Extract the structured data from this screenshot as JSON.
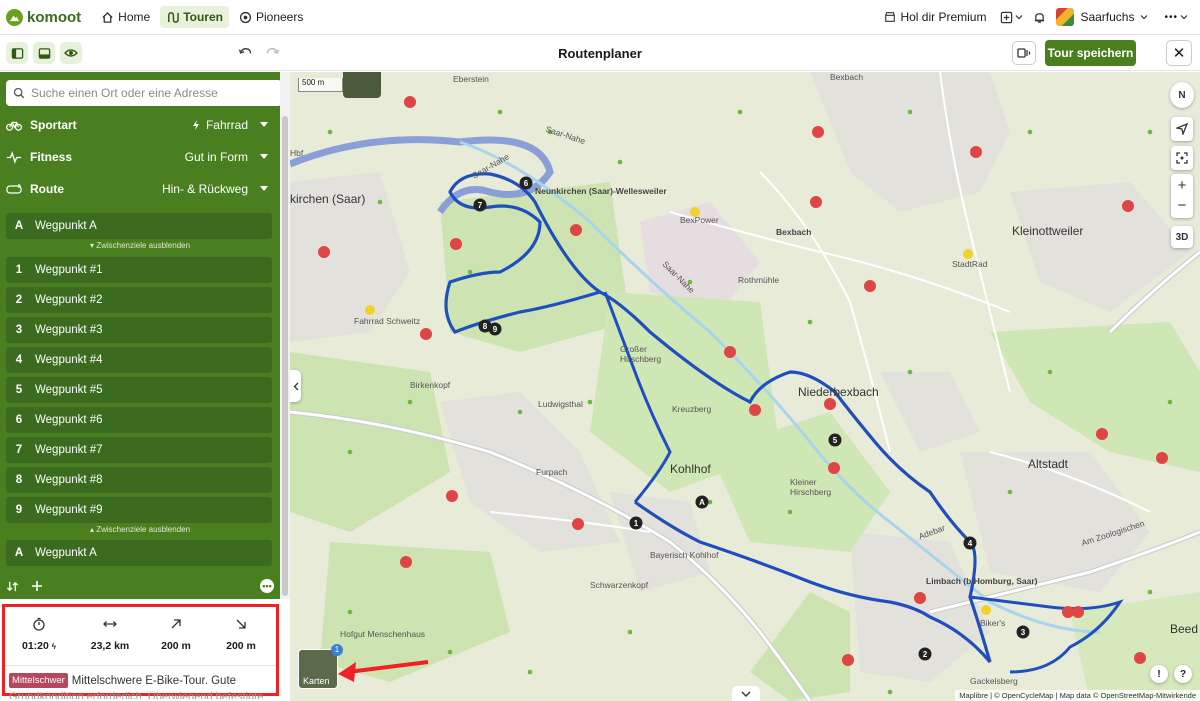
{
  "nav": {
    "logo": "komoot",
    "home": "Home",
    "tours": "Touren",
    "pioneers": "Pioneers",
    "premium": "Hol dir Premium",
    "user": "Saarfuchs",
    "more": "•••"
  },
  "toolbar": {
    "title": "Routenplaner",
    "save_label": "Tour speichern",
    "close": "✕"
  },
  "search": {
    "placeholder": "Suche einen Ort oder eine Adresse"
  },
  "options": [
    {
      "label": "Sportart",
      "value": "Fahrrad"
    },
    {
      "label": "Fitness",
      "value": "Gut in Form"
    },
    {
      "label": "Route",
      "value": "Hin- & Rückweg"
    }
  ],
  "waypoints": {
    "start": {
      "badge": "A",
      "label": "Wegpunkt A"
    },
    "hide_label": "Zwischenziele ausblenden",
    "items": [
      {
        "n": "1",
        "label": "Wegpunkt #1"
      },
      {
        "n": "2",
        "label": "Wegpunkt #2"
      },
      {
        "n": "3",
        "label": "Wegpunkt #3"
      },
      {
        "n": "4",
        "label": "Wegpunkt #4"
      },
      {
        "n": "5",
        "label": "Wegpunkt #5"
      },
      {
        "n": "6",
        "label": "Wegpunkt #6"
      },
      {
        "n": "7",
        "label": "Wegpunkt #7"
      },
      {
        "n": "8",
        "label": "Wegpunkt #8"
      },
      {
        "n": "9",
        "label": "Wegpunkt #9"
      }
    ],
    "end": {
      "badge": "A",
      "label": "Wegpunkt A"
    }
  },
  "stats": {
    "duration": "01:20",
    "distance": "23,2 km",
    "ascent": "200 m",
    "descent": "200 m",
    "difficulty_badge": "Mittelschwer",
    "difficulty_text": "Mittelschwere E-Bike-Tour. Gute",
    "difficulty_text2": "Grundkondition erforderlich. Überwiegend befestigte"
  },
  "map": {
    "scale": "500 m",
    "compass": "N",
    "zoom_in": "+",
    "zoom_out": "−",
    "three_d": "3D",
    "layers_label": "Karten",
    "layers_badge": "1",
    "attribution": "Maplibre | © OpenCycleMap | Map data © OpenStreetMap-Mitwirkende",
    "help": "?",
    "labels": {
      "eberstein": "Eberstein",
      "bexbach": "Bexbach",
      "bexbach2": "Bexbach",
      "hbf": "Hbf",
      "kirchen": "kirchen (Saar)",
      "neunkirchen": "Neunkirchen (Saar)-Wellesweiler",
      "bexpower": "BexPower",
      "kleinottweiler": "Kleinottweiler",
      "stadtrad": "StadtRad",
      "rothmuehle": "Rothmühle",
      "fahrrad_schweitzer": "Fahrrad Schweitz",
      "saar_nahe": "Saar-Nahe",
      "saar_nahe2": "Saar-Nahe",
      "saar_nahe3": "Saar-Nahe",
      "grosser_hirschberg": "Großer Hirschberg",
      "birkenkopf": "Birkenkopf",
      "ludwigsthal": "Ludwigsthal",
      "kreuzberg": "Kreuzberg",
      "niederbexbach": "Niederbexbach",
      "furpach": "Furpach",
      "kohlhof": "Kohlhof",
      "kleiner_hirschberg": "Kleiner Hirschberg",
      "altstadt": "Altstadt",
      "bayerisch_kohlhof": "Bayerisch Kohlhof",
      "schwarzenkopf": "Schwarzenkopf",
      "limbach": "Limbach (b Homburg, Saar)",
      "hofgut": "Hofgut Menschenhaus",
      "biker": "Biker's",
      "adebar": "Adebar",
      "zoo": "Am Zoologischen",
      "beed": "Beed",
      "gackelsberg": "Gackelsberg"
    }
  }
}
